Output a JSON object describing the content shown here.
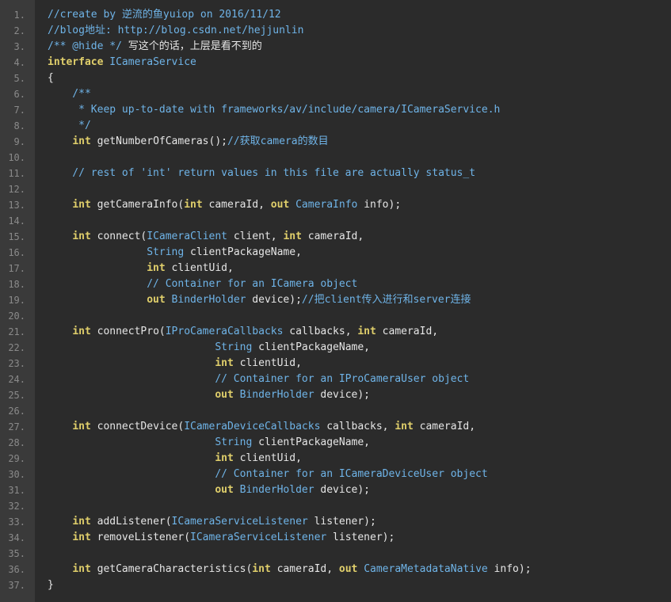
{
  "colors": {
    "background": "#2b2b2b",
    "gutter": "#3a3a3a",
    "line_number": "#8a8a8a",
    "plain": "#e6e6e6",
    "keyword": "#e0cf6b",
    "type": "#6fb4e8",
    "comment": "#6fb4e8"
  },
  "lines": [
    {
      "n": "1.",
      "tokens": [
        {
          "t": "//create by 逆流的鱼yuiop on 2016/11/12",
          "k": "comment"
        }
      ]
    },
    {
      "n": "2.",
      "tokens": [
        {
          "t": "//blog地址: http://blog.csdn.net/hejjunlin",
          "k": "comment"
        }
      ]
    },
    {
      "n": "3.",
      "tokens": [
        {
          "t": "/** @hide */ ",
          "k": "comment"
        },
        {
          "t": "写这个的话，上层是看不到的",
          "k": "plain"
        }
      ]
    },
    {
      "n": "4.",
      "tokens": [
        {
          "t": "interface",
          "k": "keyword"
        },
        {
          "t": " ",
          "k": "plain"
        },
        {
          "t": "ICameraService",
          "k": "type"
        }
      ]
    },
    {
      "n": "5.",
      "tokens": [
        {
          "t": "{",
          "k": "plain"
        }
      ]
    },
    {
      "n": "6.",
      "tokens": [
        {
          "t": "    /**",
          "k": "comment"
        }
      ]
    },
    {
      "n": "7.",
      "tokens": [
        {
          "t": "     * Keep up-to-date with frameworks/av/include/camera/ICameraService.h",
          "k": "comment"
        }
      ]
    },
    {
      "n": "8.",
      "tokens": [
        {
          "t": "     */",
          "k": "comment"
        }
      ]
    },
    {
      "n": "9.",
      "tokens": [
        {
          "t": "    ",
          "k": "plain"
        },
        {
          "t": "int",
          "k": "keyword"
        },
        {
          "t": " getNumberOfCameras();",
          "k": "plain"
        },
        {
          "t": "//获取camera的数目",
          "k": "comment"
        }
      ]
    },
    {
      "n": "10.",
      "tokens": []
    },
    {
      "n": "11.",
      "tokens": [
        {
          "t": "    // rest of 'int' return values in this file are actually status_t",
          "k": "comment"
        }
      ]
    },
    {
      "n": "12.",
      "tokens": []
    },
    {
      "n": "13.",
      "tokens": [
        {
          "t": "    ",
          "k": "plain"
        },
        {
          "t": "int",
          "k": "keyword"
        },
        {
          "t": " getCameraInfo(",
          "k": "plain"
        },
        {
          "t": "int",
          "k": "keyword"
        },
        {
          "t": " cameraId, ",
          "k": "plain"
        },
        {
          "t": "out",
          "k": "keyword"
        },
        {
          "t": " ",
          "k": "plain"
        },
        {
          "t": "CameraInfo",
          "k": "type"
        },
        {
          "t": " info);",
          "k": "plain"
        }
      ]
    },
    {
      "n": "14.",
      "tokens": []
    },
    {
      "n": "15.",
      "tokens": [
        {
          "t": "    ",
          "k": "plain"
        },
        {
          "t": "int",
          "k": "keyword"
        },
        {
          "t": " connect(",
          "k": "plain"
        },
        {
          "t": "ICameraClient",
          "k": "type"
        },
        {
          "t": " client, ",
          "k": "plain"
        },
        {
          "t": "int",
          "k": "keyword"
        },
        {
          "t": " cameraId,",
          "k": "plain"
        }
      ]
    },
    {
      "n": "16.",
      "tokens": [
        {
          "t": "                ",
          "k": "plain"
        },
        {
          "t": "String",
          "k": "type"
        },
        {
          "t": " clientPackageName,",
          "k": "plain"
        }
      ]
    },
    {
      "n": "17.",
      "tokens": [
        {
          "t": "                ",
          "k": "plain"
        },
        {
          "t": "int",
          "k": "keyword"
        },
        {
          "t": " clientUid,",
          "k": "plain"
        }
      ]
    },
    {
      "n": "18.",
      "tokens": [
        {
          "t": "                // Container for an ICamera object",
          "k": "comment"
        }
      ]
    },
    {
      "n": "19.",
      "tokens": [
        {
          "t": "                ",
          "k": "plain"
        },
        {
          "t": "out",
          "k": "keyword"
        },
        {
          "t": " ",
          "k": "plain"
        },
        {
          "t": "BinderHolder",
          "k": "type"
        },
        {
          "t": " device);",
          "k": "plain"
        },
        {
          "t": "//把client传入进行和server连接",
          "k": "comment"
        }
      ]
    },
    {
      "n": "20.",
      "tokens": []
    },
    {
      "n": "21.",
      "tokens": [
        {
          "t": "    ",
          "k": "plain"
        },
        {
          "t": "int",
          "k": "keyword"
        },
        {
          "t": " connectPro(",
          "k": "plain"
        },
        {
          "t": "IProCameraCallbacks",
          "k": "type"
        },
        {
          "t": " callbacks, ",
          "k": "plain"
        },
        {
          "t": "int",
          "k": "keyword"
        },
        {
          "t": " cameraId,",
          "k": "plain"
        }
      ]
    },
    {
      "n": "22.",
      "tokens": [
        {
          "t": "                           ",
          "k": "plain"
        },
        {
          "t": "String",
          "k": "type"
        },
        {
          "t": " clientPackageName,",
          "k": "plain"
        }
      ]
    },
    {
      "n": "23.",
      "tokens": [
        {
          "t": "                           ",
          "k": "plain"
        },
        {
          "t": "int",
          "k": "keyword"
        },
        {
          "t": " clientUid,",
          "k": "plain"
        }
      ]
    },
    {
      "n": "24.",
      "tokens": [
        {
          "t": "                           // Container for an IProCameraUser object",
          "k": "comment"
        }
      ]
    },
    {
      "n": "25.",
      "tokens": [
        {
          "t": "                           ",
          "k": "plain"
        },
        {
          "t": "out",
          "k": "keyword"
        },
        {
          "t": " ",
          "k": "plain"
        },
        {
          "t": "BinderHolder",
          "k": "type"
        },
        {
          "t": " device);",
          "k": "plain"
        }
      ]
    },
    {
      "n": "26.",
      "tokens": []
    },
    {
      "n": "27.",
      "tokens": [
        {
          "t": "    ",
          "k": "plain"
        },
        {
          "t": "int",
          "k": "keyword"
        },
        {
          "t": " connectDevice(",
          "k": "plain"
        },
        {
          "t": "ICameraDeviceCallbacks",
          "k": "type"
        },
        {
          "t": " callbacks, ",
          "k": "plain"
        },
        {
          "t": "int",
          "k": "keyword"
        },
        {
          "t": " cameraId,",
          "k": "plain"
        }
      ]
    },
    {
      "n": "28.",
      "tokens": [
        {
          "t": "                           ",
          "k": "plain"
        },
        {
          "t": "String",
          "k": "type"
        },
        {
          "t": " clientPackageName,",
          "k": "plain"
        }
      ]
    },
    {
      "n": "29.",
      "tokens": [
        {
          "t": "                           ",
          "k": "plain"
        },
        {
          "t": "int",
          "k": "keyword"
        },
        {
          "t": " clientUid,",
          "k": "plain"
        }
      ]
    },
    {
      "n": "30.",
      "tokens": [
        {
          "t": "                           // Container for an ICameraDeviceUser object",
          "k": "comment"
        }
      ]
    },
    {
      "n": "31.",
      "tokens": [
        {
          "t": "                           ",
          "k": "plain"
        },
        {
          "t": "out",
          "k": "keyword"
        },
        {
          "t": " ",
          "k": "plain"
        },
        {
          "t": "BinderHolder",
          "k": "type"
        },
        {
          "t": " device);",
          "k": "plain"
        }
      ]
    },
    {
      "n": "32.",
      "tokens": []
    },
    {
      "n": "33.",
      "tokens": [
        {
          "t": "    ",
          "k": "plain"
        },
        {
          "t": "int",
          "k": "keyword"
        },
        {
          "t": " addListener(",
          "k": "plain"
        },
        {
          "t": "ICameraServiceListener",
          "k": "type"
        },
        {
          "t": " listener);",
          "k": "plain"
        }
      ]
    },
    {
      "n": "34.",
      "tokens": [
        {
          "t": "    ",
          "k": "plain"
        },
        {
          "t": "int",
          "k": "keyword"
        },
        {
          "t": " removeListener(",
          "k": "plain"
        },
        {
          "t": "ICameraServiceListener",
          "k": "type"
        },
        {
          "t": " listener);",
          "k": "plain"
        }
      ]
    },
    {
      "n": "35.",
      "tokens": []
    },
    {
      "n": "36.",
      "tokens": [
        {
          "t": "    ",
          "k": "plain"
        },
        {
          "t": "int",
          "k": "keyword"
        },
        {
          "t": " getCameraCharacteristics(",
          "k": "plain"
        },
        {
          "t": "int",
          "k": "keyword"
        },
        {
          "t": " cameraId, ",
          "k": "plain"
        },
        {
          "t": "out",
          "k": "keyword"
        },
        {
          "t": " ",
          "k": "plain"
        },
        {
          "t": "CameraMetadataNative",
          "k": "type"
        },
        {
          "t": " info);",
          "k": "plain"
        }
      ]
    },
    {
      "n": "37.",
      "tokens": [
        {
          "t": "}",
          "k": "plain"
        }
      ]
    }
  ]
}
